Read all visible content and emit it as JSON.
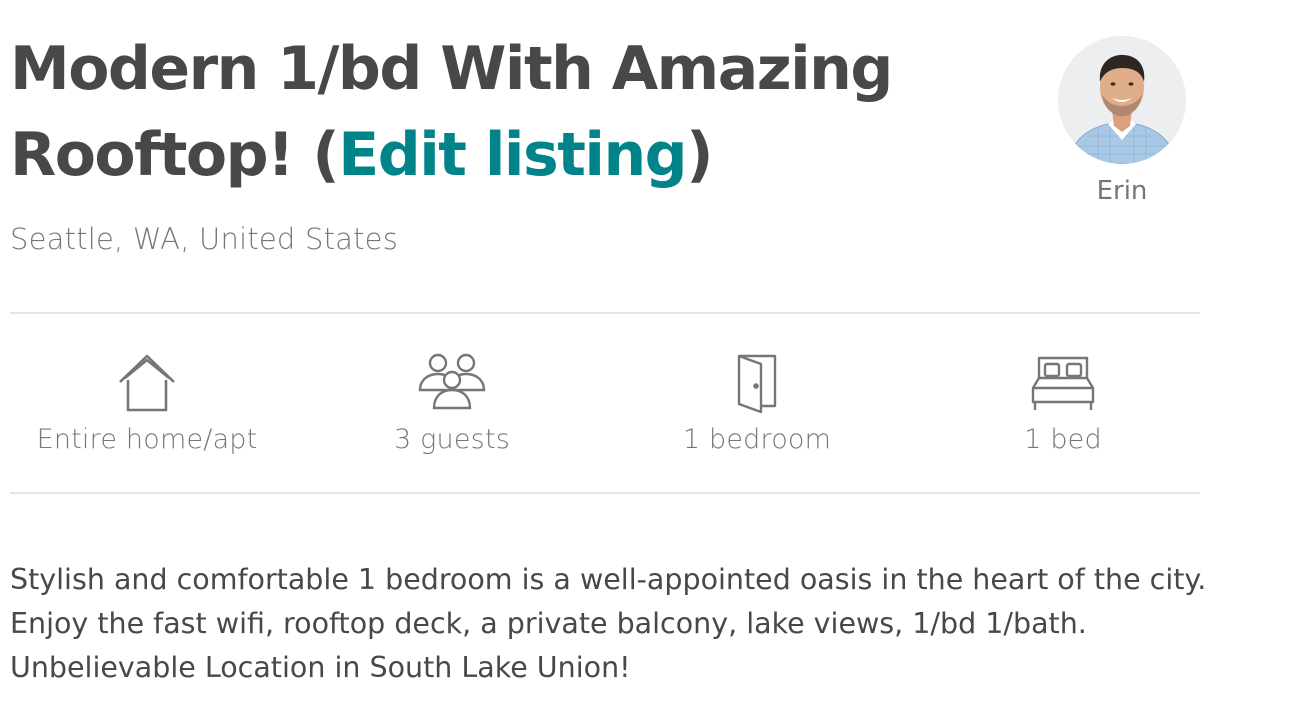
{
  "listing": {
    "title": "Modern 1/bd With Amazing Rooftop!",
    "title_open_paren": " (",
    "edit_link_label": "Edit listing",
    "title_close_paren": ")",
    "location": "Seattle, WA, United States"
  },
  "host": {
    "name": "Erin",
    "avatar": "host-photo"
  },
  "summary": {
    "items": [
      {
        "icon": "house-icon",
        "label": "Entire home/apt"
      },
      {
        "icon": "guests-icon",
        "label": "3 guests"
      },
      {
        "icon": "door-icon",
        "label": "1 bedroom"
      },
      {
        "icon": "bed-icon",
        "label": "1 bed"
      }
    ]
  },
  "description": "Stylish and comfortable 1 bedroom is a well-appointed oasis in the heart of the city. Enjoy the fast wifi, rooftop deck, a private balcony, lake views, 1/bd 1/bath. Unbelievable Location in South Lake Union!",
  "colors": {
    "text": "#484848",
    "muted": "#767676",
    "link": "#008489",
    "divider": "#e4e4e4"
  }
}
